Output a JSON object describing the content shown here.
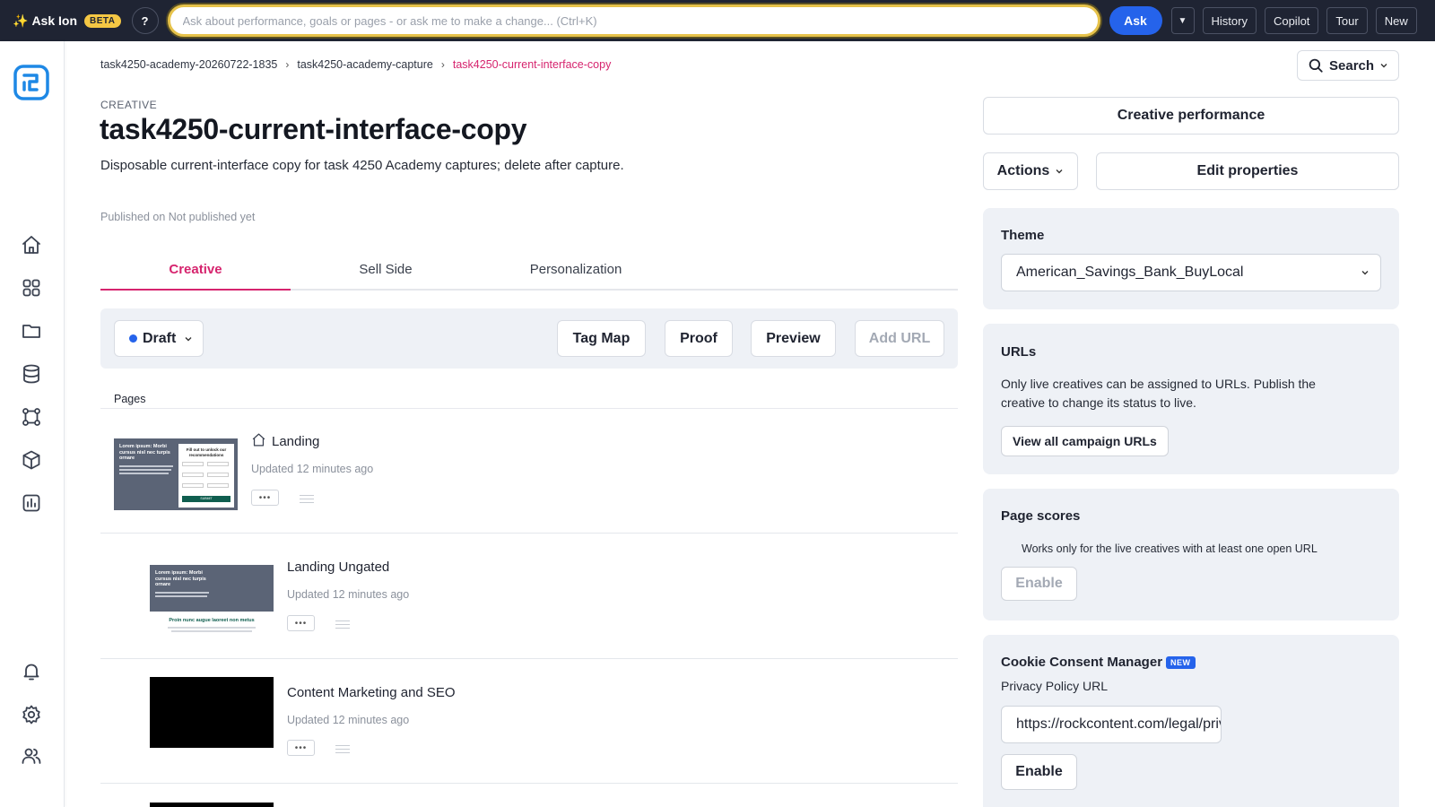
{
  "topbar": {
    "ask_label": "Ask Ion",
    "beta_label": "BETA",
    "help_label": "?",
    "ask_placeholder": "Ask about performance, goals or pages - or ask me to make a change... (Ctrl+K)",
    "ask_button": "Ask",
    "history": "History",
    "copilot": "Copilot",
    "tour": "Tour",
    "new": "New"
  },
  "breadcrumb": [
    "task4250-academy-20260722-1835",
    "task4250-academy-capture",
    "task4250-current-interface-copy"
  ],
  "search_label": "Search",
  "header": {
    "kicker": "CREATIVE",
    "title": "task4250-current-interface-copy",
    "description": "Disposable current-interface copy for task 4250 Academy captures; delete after capture.",
    "published": "Published on Not published yet"
  },
  "tabs": [
    {
      "label": "Creative",
      "active": true
    },
    {
      "label": "Sell Side",
      "active": false
    },
    {
      "label": "Personalization",
      "active": false
    }
  ],
  "toolbar": {
    "status": "Draft",
    "tag_map": "Tag Map",
    "proof": "Proof",
    "preview": "Preview",
    "add_url": "Add URL"
  },
  "pages_label": "Pages",
  "pages": [
    {
      "name": "Landing",
      "updated": "Updated 12 minutes ago",
      "home": true,
      "thumb": {
        "heading": "Lorem ipsum: Morbi cursus nisl nec turpis ornare",
        "form_title": "Fill out to unlock our recommendations",
        "submit": "SUBMIT"
      }
    },
    {
      "name": "Landing Ungated",
      "updated": "Updated 12 minutes ago",
      "home": false,
      "thumb": {
        "heading": "Lorem ipsum: Morbi cursus nisl nec turpis ornare",
        "subheading": "Proin nunc augue laoreet non metus"
      }
    },
    {
      "name": "Content Marketing and SEO",
      "updated": "Updated 12 minutes ago",
      "home": false
    }
  ],
  "right": {
    "creative_performance": "Creative performance",
    "actions": "Actions",
    "edit_properties": "Edit properties",
    "theme": {
      "title": "Theme",
      "value": "American_Savings_Bank_BuyLocal"
    },
    "urls": {
      "title": "URLs",
      "text": "Only live creatives can be assigned to URLs. Publish the creative to change its status to live.",
      "button": "View all campaign URLs"
    },
    "page_scores": {
      "title": "Page scores",
      "text": "Works only for the live creatives with at least one open URL",
      "button": "Enable"
    },
    "cookie": {
      "title": "Cookie Consent Manager",
      "badge": "NEW",
      "label": "Privacy Policy URL",
      "value": "https://rockcontent.com/legal/privacy-policy",
      "button": "Enable"
    }
  },
  "colors": {
    "accent": "#d6246e",
    "primary": "#2563eb",
    "topbar": "#1f2433",
    "panel": "#eef1f6"
  },
  "icons": [
    "sparkle-icon",
    "search-icon",
    "home-icon",
    "grid-icon",
    "folder-icon",
    "database-icon",
    "integrations-icon",
    "cube-icon",
    "chart-icon",
    "bell-icon",
    "gear-icon",
    "users-icon",
    "chevron-down-icon"
  ]
}
